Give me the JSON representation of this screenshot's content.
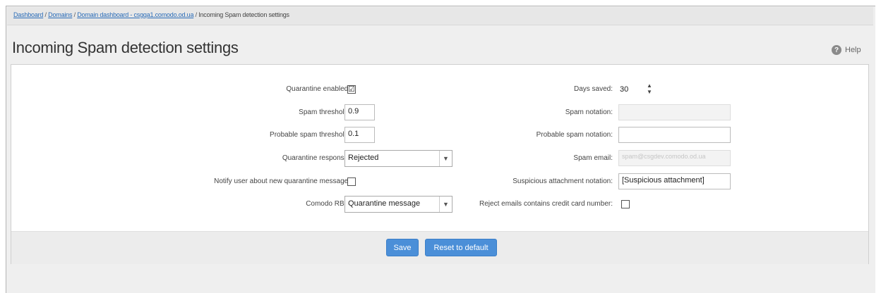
{
  "breadcrumb": {
    "items": [
      "Dashboard",
      "Domains",
      "Domain dashboard - csgqa1.comodo.od.ua"
    ],
    "separator": "/",
    "current": "Incoming Spam detection settings"
  },
  "page_title": "Incoming Spam detection settings",
  "help": {
    "icon": "question-circle-icon",
    "label": "Help"
  },
  "form": {
    "quarantine_enabled": {
      "label": "Quarantine enabled:",
      "checked": true,
      "mark": "☑"
    },
    "spam_threshold": {
      "label": "Spam threshold:",
      "value": "0.9"
    },
    "probable_spam_threshold": {
      "label": "Probable spam threshold:",
      "value": "0.1"
    },
    "quarantine_response": {
      "label": "Quarantine response:",
      "value": "Rejected"
    },
    "notify_user": {
      "label": "Notify user about new quarantine message:",
      "checked": false
    },
    "comodo_rbl": {
      "label": "Comodo RBL:",
      "value": "Quarantine message"
    },
    "days_saved": {
      "label": "Days saved:",
      "value": "30"
    },
    "spam_notation": {
      "label": "Spam notation:",
      "value": ""
    },
    "probable_spam_notation": {
      "label": "Probable spam notation:",
      "value": ""
    },
    "spam_email": {
      "label": "Spam email:",
      "value": "spam@csgdev.comodo.od.ua"
    },
    "suspicious_attachment_notation": {
      "label": "Suspicious attachment notation:",
      "value": "[Suspicious attachment]"
    },
    "reject_credit_card": {
      "label": "Reject emails contains credit card number:",
      "checked": false
    }
  },
  "buttons": {
    "save": "Save",
    "reset": "Reset to default"
  },
  "colors": {
    "accent": "#4b8fd8",
    "link": "#2a6cb8"
  }
}
